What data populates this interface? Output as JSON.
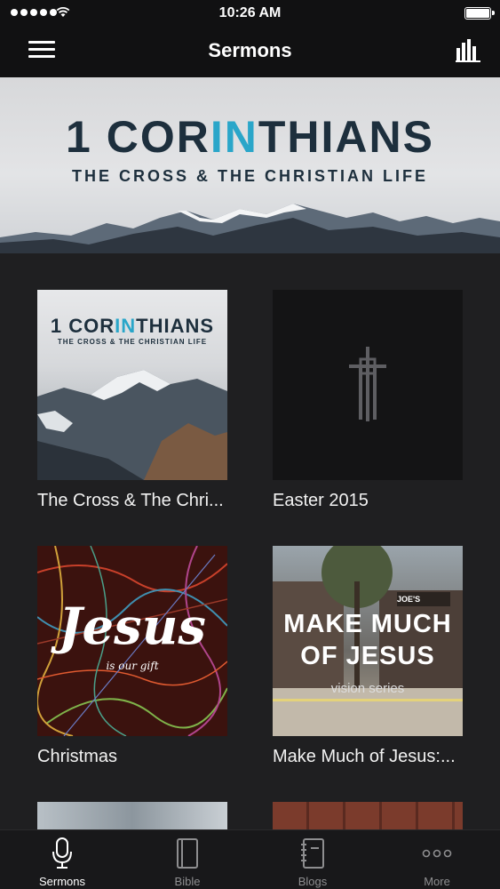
{
  "status_bar": {
    "time": "10:26 AM"
  },
  "nav": {
    "title": "Sermons"
  },
  "hero": {
    "title_part1": "1 COR",
    "title_part2": "IN",
    "title_part3": "THIANS",
    "subtitle": "THE CROSS & THE CHRISTIAN LIFE"
  },
  "series": [
    {
      "label": "The Cross & The Chri...",
      "art_title_part1": "1 COR",
      "art_title_part2": "IN",
      "art_title_part3": "THIANS",
      "art_subtitle": "THE CROSS & THE CHRISTIAN LIFE"
    },
    {
      "label": "Easter 2015"
    },
    {
      "label": "Christmas",
      "art_title": "Jesus",
      "art_subtitle": "is our gift"
    },
    {
      "label": "Make Much of Jesus:...",
      "art_line1": "MAKE MUCH",
      "art_line2": "OF JESUS",
      "art_subtitle": "vision series",
      "sign_text": "JOE'S"
    }
  ],
  "tabs": [
    {
      "label": "Sermons",
      "icon": "microphone-icon",
      "active": true
    },
    {
      "label": "Bible",
      "icon": "book-icon"
    },
    {
      "label": "Blogs",
      "icon": "notebook-icon"
    },
    {
      "label": "More",
      "icon": "more-dots-icon"
    }
  ],
  "colors": {
    "accent": "#2aa6c9",
    "navy": "#1d2f3d",
    "background": "#1f1f21",
    "bar": "#111112"
  }
}
